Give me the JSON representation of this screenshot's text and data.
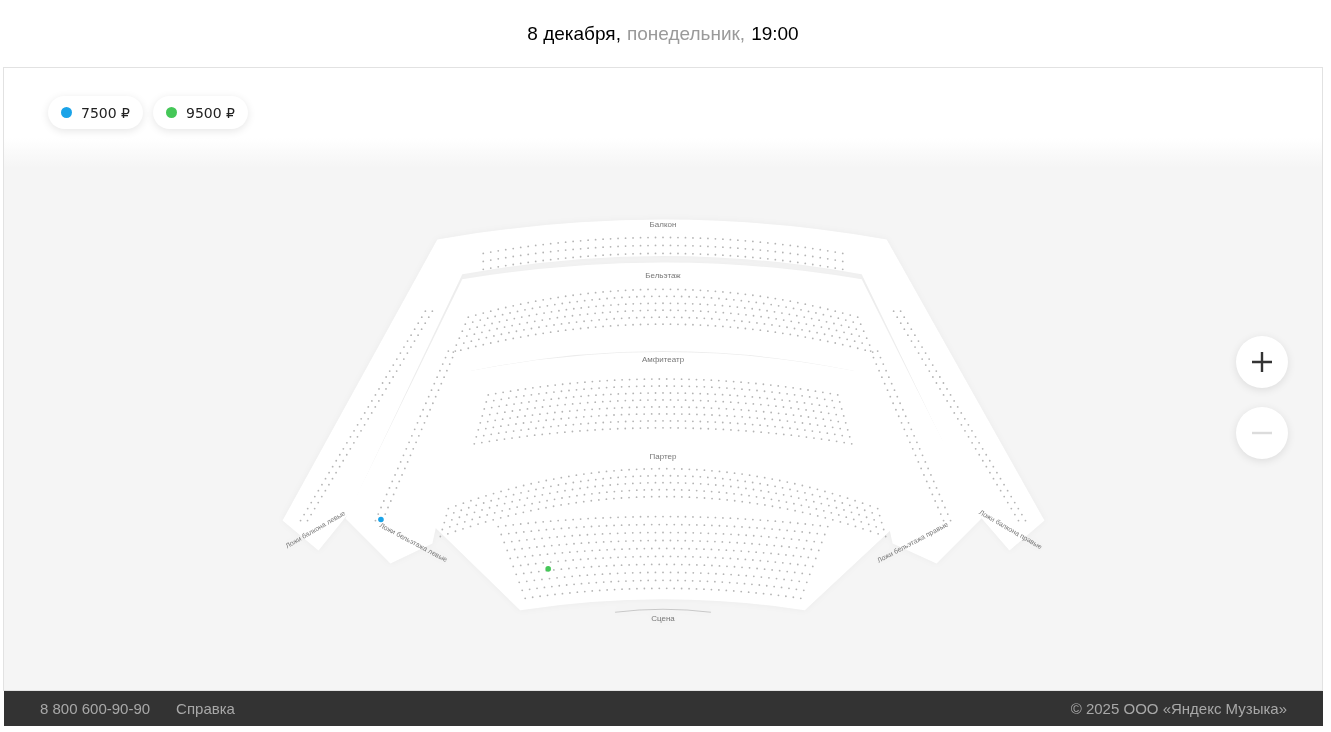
{
  "header": {
    "date": "8 декабря,",
    "weekday": "понедельник,",
    "time": "19:00"
  },
  "legend": [
    {
      "price": "7500 ₽",
      "color": "#1aa3e8"
    },
    {
      "price": "9500 ₽",
      "color": "#45c758"
    }
  ],
  "sections": [
    {
      "kind": "balcony",
      "label": "Балкон"
    },
    {
      "kind": "beletage",
      "label": "Бельэтаж"
    },
    {
      "kind": "amphitheatre",
      "label": "Амфитеатр"
    },
    {
      "kind": "parterre",
      "label": "Партер"
    }
  ],
  "loges": [
    {
      "label": "Ложи балкона левые"
    },
    {
      "label": "Ложи бельэтажа левые"
    },
    {
      "label": "Ложи бельэтажа правые"
    },
    {
      "label": "Ложи балкона правые"
    }
  ],
  "available_seats": [
    {
      "color": "#1aa3e8"
    },
    {
      "color": "#45c758"
    }
  ],
  "stage": {
    "label": "Сцена"
  },
  "zoom": {
    "zoom_in_disabled": false,
    "zoom_out_disabled": true
  },
  "footer": {
    "phone": "8 800 600-90-90",
    "help": "Справка",
    "copyright": "© 2025 ООО «Яндекс Музыка»"
  }
}
